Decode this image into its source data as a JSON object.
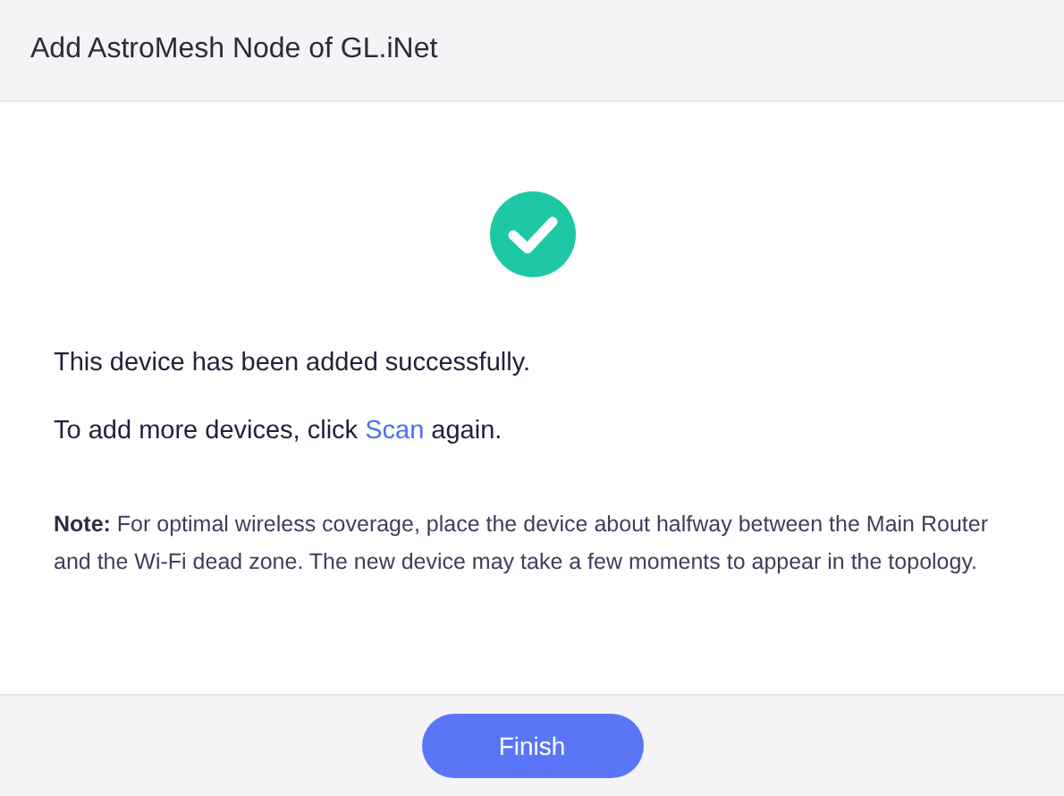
{
  "dialog": {
    "title": "Add AstroMesh Node of GL.iNet"
  },
  "status": {
    "kind": "success"
  },
  "message": "This device has been added successfully.",
  "more": {
    "before": "To add more devices, click ",
    "link": "Scan",
    "after": " again."
  },
  "note": "**Note:** For optimal wireless coverage, place the device about halfway between the Main Router and the Wi-Fi dead zone. The new device may take a few moments to appear in the topology.",
  "buttons": [
    "Finish"
  ]
}
